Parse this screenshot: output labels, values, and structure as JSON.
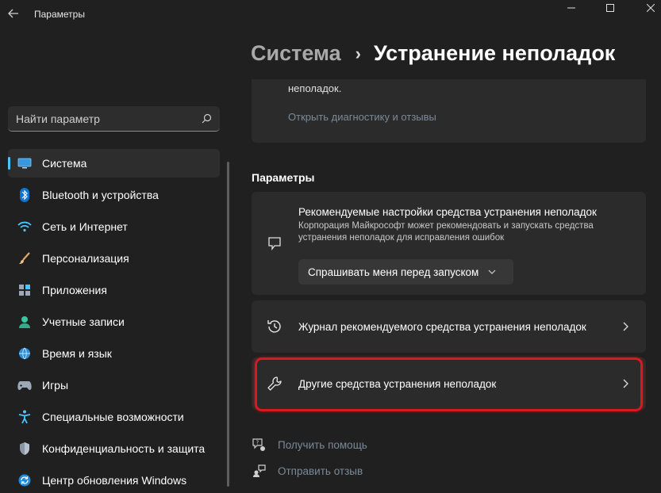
{
  "window": {
    "app_title": "Параметры"
  },
  "search": {
    "placeholder": "Найти параметр"
  },
  "sidebar": {
    "items": [
      {
        "label": "Система",
        "icon": "system-icon"
      },
      {
        "label": "Bluetooth и устройства",
        "icon": "bluetooth-icon"
      },
      {
        "label": "Сеть и Интернет",
        "icon": "wifi-icon"
      },
      {
        "label": "Персонализация",
        "icon": "brush-icon"
      },
      {
        "label": "Приложения",
        "icon": "apps-icon"
      },
      {
        "label": "Учетные записи",
        "icon": "user-icon"
      },
      {
        "label": "Время и язык",
        "icon": "globe-icon"
      },
      {
        "label": "Игры",
        "icon": "gamepad-icon"
      },
      {
        "label": "Специальные возможности",
        "icon": "accessibility-icon"
      },
      {
        "label": "Конфиденциальность и защита",
        "icon": "shield-icon"
      },
      {
        "label": "Центр обновления Windows",
        "icon": "update-icon"
      }
    ]
  },
  "breadcrumb": {
    "parent": "Система",
    "separator": "›",
    "current": "Устранение неполадок"
  },
  "top_card": {
    "text": "неполадок.",
    "link": "Открыть диагностику и отзывы"
  },
  "section": {
    "title": "Параметры"
  },
  "recommended": {
    "title": "Рекомендуемые настройки средства устранения неполадок",
    "description": "Корпорация Майкрософт может рекомендовать и запускать средства устранения неполадок для исправления ошибок",
    "dropdown_value": "Спрашивать меня перед запуском"
  },
  "history": {
    "label": "Журнал рекомендуемого средства устранения неполадок"
  },
  "other": {
    "label": "Другие средства устранения неполадок"
  },
  "footer": {
    "help": "Получить помощь",
    "feedback": "Отправить отзыв"
  },
  "colors": {
    "background": "#202020",
    "card": "#2b2b2b",
    "accent": "#4cc2ff",
    "highlight": "#d71920",
    "link": "#7a8a99"
  }
}
